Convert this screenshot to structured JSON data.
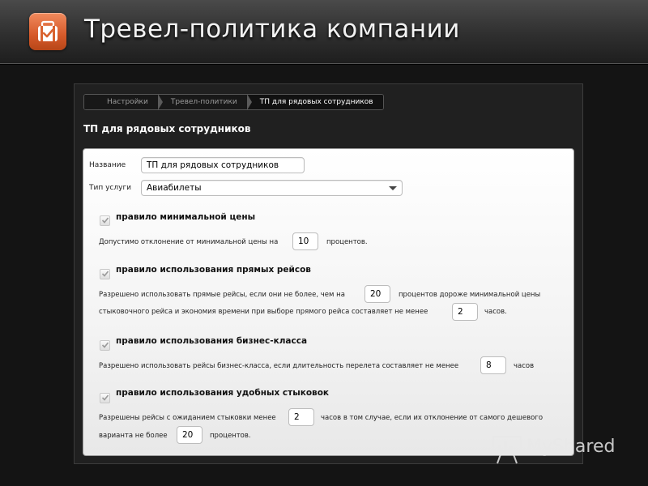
{
  "header": {
    "title": "Тревел-политика компании",
    "icon": "briefcase-check-icon",
    "icon_color": "#e06a37"
  },
  "breadcrumb": [
    "Настройки",
    "Тревел-политики",
    "ТП для рядовых сотрудников"
  ],
  "section_title": "ТП для рядовых сотрудников",
  "form": {
    "name_label": "Название",
    "name_value": "ТП для рядовых сотрудников",
    "service_label": "Тип услуги",
    "service_value": "Авиабилеты"
  },
  "rules": [
    {
      "title": "правило минимальной цены",
      "checked": true,
      "line1_before": "Допустимо отклонение от минимальной цены на",
      "value1": "10",
      "line1_after": "процентов."
    },
    {
      "title": "правило использования прямых рейсов",
      "checked": true,
      "line1_before": "Разрешено использовать прямые рейсы, если они не более, чем на",
      "value1": "20",
      "line1_after": "процентов дороже минимальной цены",
      "line2_before": "стыковочного рейса и экономия времени при выборе прямого рейса составляет не менее",
      "value2": "2",
      "line2_after": "часов."
    },
    {
      "title": "правило использования бизнес-класса",
      "checked": true,
      "line1_before": "Разрешено использовать рейсы бизнес-класса, если длительность перелета составляет не менее",
      "value1": "8",
      "line1_after": "часов"
    },
    {
      "title": "правило использования удобных стыковок",
      "checked": true,
      "line1_before": "Разрешены рейсы с ожиданием стыковки менее",
      "value1": "2",
      "line1_after": "часов в том случае, если их отклонение от самого дешевого",
      "line2_before": "варианта не более",
      "value2": "20",
      "line2_after": "процентов."
    }
  ],
  "watermark": {
    "text": "MyShared",
    "icon": "presentation-board-icon"
  }
}
